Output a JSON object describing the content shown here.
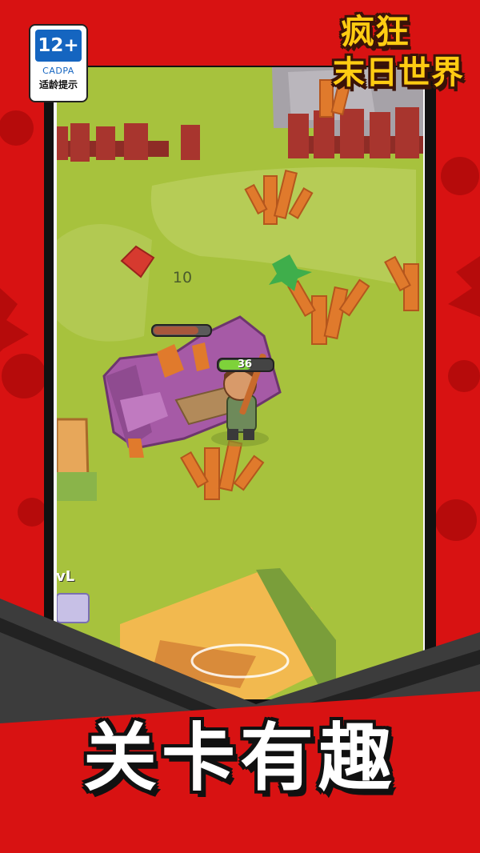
{
  "age_rating": {
    "rating": "12+",
    "org": "CADPA",
    "tip": "适龄提示"
  },
  "logo": {
    "line1": "疯狂",
    "line2": "末日世界"
  },
  "game": {
    "damage_number": "10",
    "player_hp_text": "36",
    "player_hp_fraction": 0.6,
    "enemy_hp_fraction": 0.8,
    "level_label": "vL"
  },
  "slogan": "关卡有趣",
  "colors": {
    "frame_red": "#d81212",
    "grass": "#a7c23d",
    "fence": "#a8352e",
    "wood": "#e07a2c",
    "sofa": "#a65aa6",
    "hp_green": "#7ed23a",
    "banner_gray": "#3c3c3c",
    "logo_yellow": "#ffcc12"
  }
}
